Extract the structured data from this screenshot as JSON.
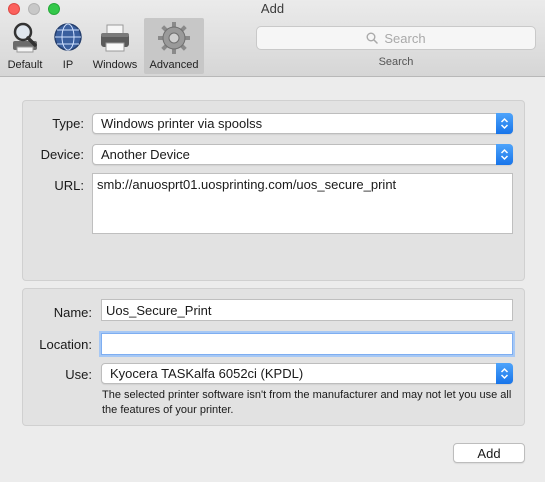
{
  "window": {
    "title": "Add"
  },
  "toolbar": {
    "tools": [
      {
        "label": "Default",
        "icon": "magnifier-printer-icon"
      },
      {
        "label": "IP",
        "icon": "globe-icon"
      },
      {
        "label": "Windows",
        "icon": "printer-icon"
      },
      {
        "label": "Advanced",
        "icon": "gear-icon",
        "selected": true
      }
    ],
    "search": {
      "placeholder": "Search",
      "caption": "Search"
    }
  },
  "form": {
    "type": {
      "label": "Type:",
      "value": "Windows printer via spoolss"
    },
    "device": {
      "label": "Device:",
      "value": "Another Device"
    },
    "url": {
      "label": "URL:",
      "value": "smb://anuosprt01.uosprinting.com/uos_secure_print"
    },
    "name": {
      "label": "Name:",
      "value": "Uos_Secure_Print"
    },
    "location": {
      "label": "Location:",
      "value": ""
    },
    "use": {
      "label": "Use:",
      "value": "Kyocera TASKalfa 6052ci (KPDL)"
    },
    "note": "The selected printer software isn't from the manufacturer and may not let you use all the features of your printer."
  },
  "actions": {
    "add_label": "Add"
  },
  "colors": {
    "accent": "#1d7bf0",
    "close": "#fc615d",
    "maximize": "#34c84a"
  }
}
